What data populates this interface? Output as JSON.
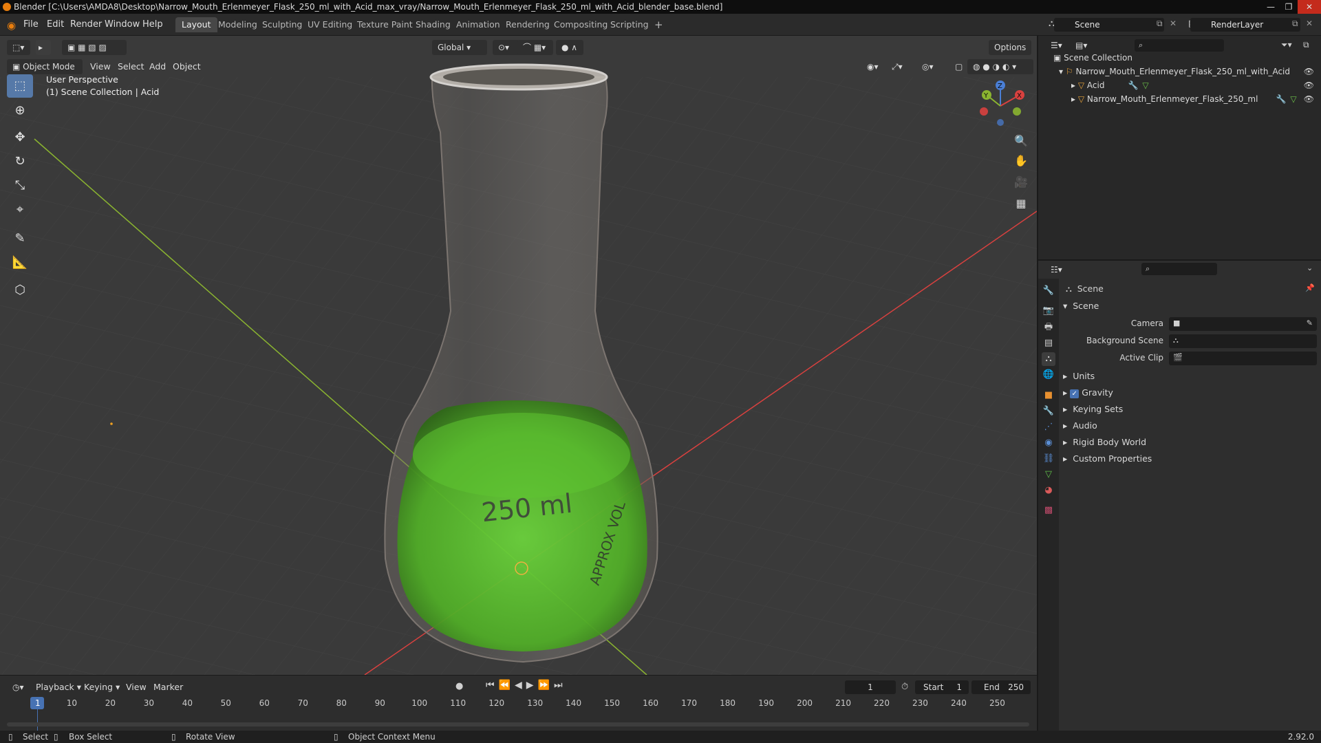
{
  "title": {
    "text": "Blender [C:\\Users\\AMDA8\\Desktop\\Narrow_Mouth_Erlenmeyer_Flask_250_ml_with_Acid_max_vray/Narrow_Mouth_Erlenmeyer_Flask_250_ml_with_Acid_blender_base.blend]",
    "minimize": "—",
    "maximize": "❐",
    "close": "✕"
  },
  "menu": {
    "items": [
      "File",
      "Edit",
      "Render",
      "Window",
      "Help"
    ],
    "workspaces": [
      "Layout",
      "Modeling",
      "Sculpting",
      "UV Editing",
      "Texture Paint",
      "Shading",
      "Animation",
      "Rendering",
      "Compositing",
      "Scripting"
    ],
    "add_tab": "+",
    "scene": "Scene",
    "render_layer": "RenderLayer"
  },
  "viewport": {
    "mode": "Object Mode",
    "menus": [
      "View",
      "Select",
      "Add",
      "Object"
    ],
    "transform_orientation": "Global",
    "options": "Options",
    "perspective": "User Perspective",
    "collection_info": "(1) Scene Collection | Acid",
    "gizmo": {
      "x": "X",
      "y": "Y",
      "z": "Z"
    }
  },
  "timeline": {
    "menus": [
      "Playback",
      "Keying",
      "View",
      "Marker"
    ],
    "current_frame": "1",
    "start_label": "Start",
    "start": "1",
    "end_label": "End",
    "end": "250",
    "ticks": [
      "1",
      "10",
      "20",
      "30",
      "40",
      "50",
      "60",
      "70",
      "80",
      "90",
      "100",
      "110",
      "120",
      "130",
      "140",
      "150",
      "160",
      "170",
      "180",
      "190",
      "200",
      "210",
      "220",
      "230",
      "240",
      "250"
    ]
  },
  "status": {
    "select": "Select",
    "box_select": "Box Select",
    "rotate": "Rotate View",
    "context": "Object Context Menu",
    "version": "2.92.0"
  },
  "outliner": {
    "root": "Scene Collection",
    "collection": "Narrow_Mouth_Erlenmeyer_Flask_250_ml_with_Acid",
    "objects": [
      "Acid",
      "Narrow_Mouth_Erlenmeyer_Flask_250_ml"
    ]
  },
  "properties": {
    "context": "Scene",
    "panel": "Scene",
    "camera_label": "Camera",
    "background_label": "Background Scene",
    "clip_label": "Active Clip",
    "sections": [
      "Units",
      "Gravity",
      "Keying Sets",
      "Audio",
      "Rigid Body World",
      "Custom Properties"
    ]
  },
  "colors": {
    "accent": "#5679a8",
    "axis_red": "#d9413f",
    "axis_green": "#8bb530",
    "liquid": "#58c42a",
    "active_frame": "#4772b3"
  }
}
